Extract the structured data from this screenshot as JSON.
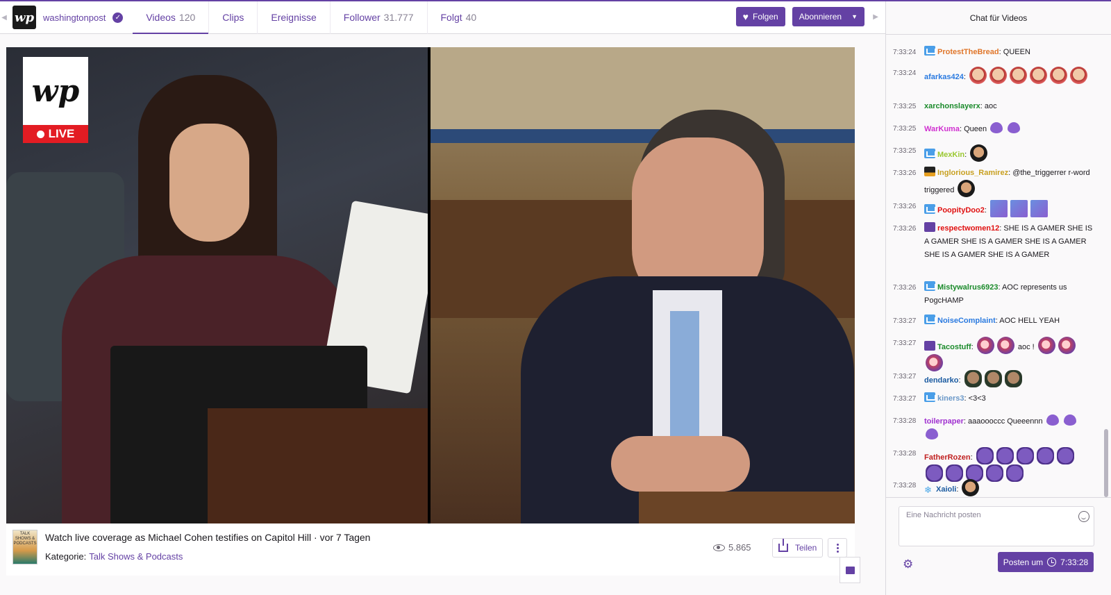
{
  "header": {
    "channel_name": "washingtonpost",
    "channel_logo": "wp",
    "tabs": [
      {
        "label": "Videos",
        "count": "120"
      },
      {
        "label": "Clips",
        "count": ""
      },
      {
        "label": "Ereignisse",
        "count": ""
      },
      {
        "label": "Follower",
        "count": "31.777"
      },
      {
        "label": "Folgt",
        "count": "40"
      }
    ],
    "follow_label": "Folgen",
    "subscribe_label": "Abonnieren"
  },
  "video": {
    "badge_logo": "wp",
    "live_label": "LIVE",
    "title": "Watch live coverage as Michael Cohen testifies on Capitol Hill",
    "age": "vor 7 Tagen",
    "category_label": "Kategorie:",
    "category": "Talk Shows & Podcasts",
    "category_thumb": "TALK SHOWS & PODCASTS",
    "views": "5.865",
    "share_label": "Teilen"
  },
  "chat": {
    "header": "Chat für Videos",
    "placeholder": "Eine Nachricht posten",
    "post_label": "Posten um",
    "post_time": "7:33:28",
    "messages": [
      {
        "time": "7:33:24",
        "name": "ProtestTheBread",
        "color": "#e0762a",
        "badge": "crown",
        "text": "QUEEN"
      },
      {
        "time": "7:33:24",
        "name": "afarkas424",
        "color": "#2a7ae0",
        "badge": "",
        "text": ""
      },
      {
        "time": "7:33:25",
        "name": "xarchonslayerx",
        "color": "#1a8a2a",
        "badge": "",
        "text": "aoc"
      },
      {
        "time": "7:33:25",
        "name": "WarKuma",
        "color": "#d030d0",
        "badge": "",
        "text": "Queen"
      },
      {
        "time": "7:33:25",
        "name": "MexKin",
        "color": "#9ac830",
        "badge": "crown",
        "text": ""
      },
      {
        "time": "7:33:26",
        "name": "Inglorious_Ramirez",
        "color": "#c8a020",
        "badge": "b2019",
        "text": "@the_triggerrer r-word triggered"
      },
      {
        "time": "7:33:26",
        "name": "PoopityDoo2",
        "color": "#e01010",
        "badge": "crown",
        "text": ""
      },
      {
        "time": "7:33:26",
        "name": "respectwomen12",
        "color": "#e01010",
        "badge": "prime",
        "text": "SHE IS A GAMER SHE IS A GAMER SHE IS A GAMER SHE IS A GAMER SHE IS A GAMER SHE IS A GAMER"
      },
      {
        "time": "7:33:26",
        "name": "Mistywalrus6923",
        "color": "#1a8a2a",
        "badge": "crown",
        "text": "AOC represents us PogcHAMP"
      },
      {
        "time": "7:33:27",
        "name": "NoiseComplaint",
        "color": "#2a7ae0",
        "badge": "crown",
        "text": "AOC HELL YEAH"
      },
      {
        "time": "7:33:27",
        "name": "Tacostuff",
        "color": "#1a8a2a",
        "badge": "prime",
        "text": "aoc !"
      },
      {
        "time": "7:33:27",
        "name": "dendarko",
        "color": "#1a5aa0",
        "badge": "",
        "text": ""
      },
      {
        "time": "7:33:27",
        "name": "kiners3",
        "color": "#6a98c8",
        "badge": "crown",
        "text": "<3<3"
      },
      {
        "time": "7:33:28",
        "name": "toilerpaper",
        "color": "#a030d0",
        "badge": "",
        "text": "aaaoooccc Queeennn"
      },
      {
        "time": "7:33:28",
        "name": "FatherRozen",
        "color": "#c02020",
        "badge": "",
        "text": ""
      },
      {
        "time": "7:33:28",
        "name": "Xaioli",
        "color": "#1a5aa0",
        "badge": "snow",
        "text": ""
      }
    ]
  },
  "colors": {
    "accent": "#6441a4",
    "live": "#e31c23"
  }
}
